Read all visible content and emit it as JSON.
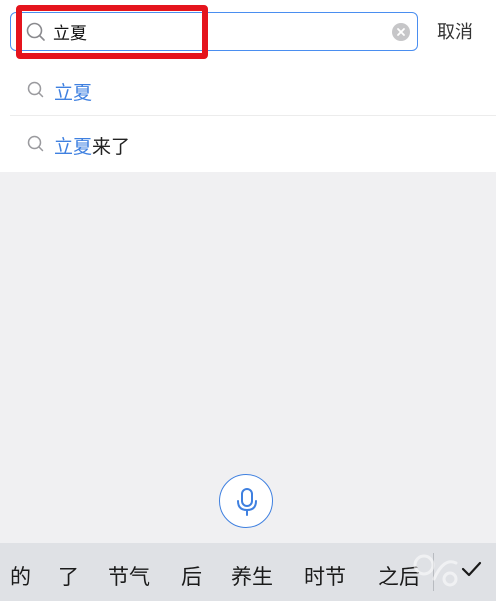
{
  "search": {
    "value": "立夏",
    "cancel_label": "取消"
  },
  "suggestions": [
    {
      "highlight": "立夏",
      "rest": ""
    },
    {
      "highlight": "立夏",
      "rest": "来了"
    }
  ],
  "candidates": [
    "的",
    "了",
    "节气",
    "后",
    "养生",
    "时节",
    "之后"
  ],
  "icons": {
    "search": "search-icon",
    "clear": "clear-icon",
    "suggestion": "search-icon",
    "mic": "microphone-icon",
    "confirm": "check-icon"
  },
  "colors": {
    "accent": "#3f80e0",
    "annotation": "#e5141d"
  }
}
